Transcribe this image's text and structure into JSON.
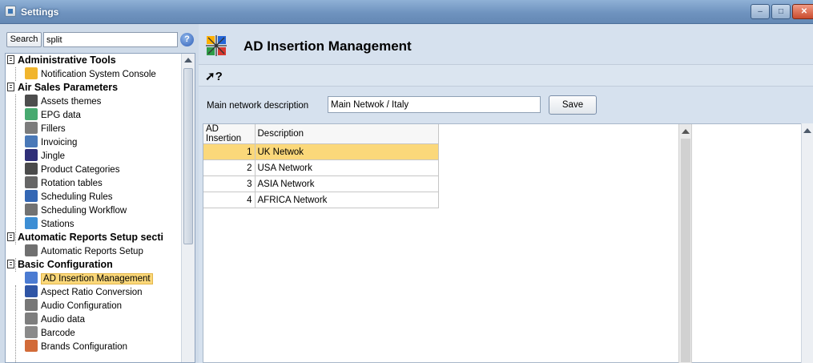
{
  "window": {
    "title": "Settings",
    "buttons": {
      "minimize": "–",
      "maximize": "□",
      "close": "✕"
    }
  },
  "search": {
    "button_label": "Search",
    "value": "split",
    "help": "?"
  },
  "tree": {
    "items": [
      {
        "type": "group",
        "label": "Administrative Tools"
      },
      {
        "type": "leaf",
        "label": "Notification System Console",
        "icon": "notification-icon",
        "color": "#f1b52d"
      },
      {
        "type": "group",
        "label": "Air Sales Parameters"
      },
      {
        "type": "leaf",
        "label": "Assets themes",
        "icon": "assets-icon",
        "color": "#4d4d4d"
      },
      {
        "type": "leaf",
        "label": "EPG data",
        "icon": "epg-icon",
        "color": "#48aa70"
      },
      {
        "type": "leaf",
        "label": "Fillers",
        "icon": "fillers-icon",
        "color": "#7c7c7c"
      },
      {
        "type": "leaf",
        "label": "Invoicing",
        "icon": "invoice-icon",
        "color": "#4a79b8"
      },
      {
        "type": "leaf",
        "label": "Jingle",
        "icon": "music-icon",
        "color": "#2f2f78"
      },
      {
        "type": "leaf",
        "label": "Product Categories",
        "icon": "product-icon",
        "color": "#4b4b4b"
      },
      {
        "type": "leaf",
        "label": "Rotation tables",
        "icon": "rotation-icon",
        "color": "#666666"
      },
      {
        "type": "leaf",
        "label": "Scheduling Rules",
        "icon": "rules-icon",
        "color": "#3467b4"
      },
      {
        "type": "leaf",
        "label": "Scheduling Workflow",
        "icon": "workflow-icon",
        "color": "#727272"
      },
      {
        "type": "leaf",
        "label": "Stations",
        "icon": "stations-icon",
        "color": "#3d8ed4"
      },
      {
        "type": "group",
        "label": "Automatic Reports Setup secti"
      },
      {
        "type": "leaf",
        "label": "Automatic Reports Setup",
        "icon": "reports-icon",
        "color": "#707070"
      },
      {
        "type": "group",
        "label": "Basic Configuration"
      },
      {
        "type": "leaf",
        "label": "AD Insertion Management",
        "icon": "ad-insertion-icon",
        "color": "#4b7bd2",
        "selected": true
      },
      {
        "type": "leaf",
        "label": "Aspect Ratio Conversion",
        "icon": "aspect-ratio-icon",
        "color": "#2f55a5"
      },
      {
        "type": "leaf",
        "label": "Audio Configuration",
        "icon": "audio-config-icon",
        "color": "#777777"
      },
      {
        "type": "leaf",
        "label": "Audio data",
        "icon": "audio-data-icon",
        "color": "#7e7e7e"
      },
      {
        "type": "leaf",
        "label": "Barcode",
        "icon": "barcode-icon",
        "color": "#8a8a8a"
      },
      {
        "type": "leaf",
        "label": "Brands Configuration",
        "icon": "brands-icon",
        "color": "#d26b39"
      }
    ]
  },
  "page": {
    "title": "AD Insertion Management",
    "help_pointer": "?"
  },
  "form": {
    "network_label": "Main network description",
    "network_value": "Main Netwok / Italy",
    "save_label": "Save"
  },
  "table": {
    "columns": [
      "AD Insertion",
      "Description"
    ],
    "rows": [
      {
        "ad_insertion": "1",
        "description": "UK Netwok",
        "selected": true
      },
      {
        "ad_insertion": "2",
        "description": "USA Network"
      },
      {
        "ad_insertion": "3",
        "description": "ASIA Network"
      },
      {
        "ad_insertion": "4",
        "description": "AFRICA Network"
      }
    ]
  }
}
